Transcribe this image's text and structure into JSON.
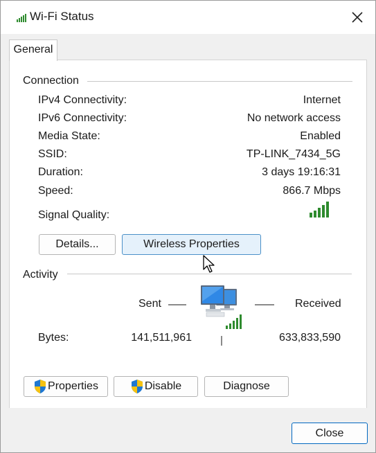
{
  "window": {
    "title": "Wi-Fi Status"
  },
  "tabs": [
    {
      "label": "General"
    }
  ],
  "connection": {
    "heading": "Connection",
    "rows": [
      {
        "label": "IPv4 Connectivity:",
        "value": "Internet"
      },
      {
        "label": "IPv6 Connectivity:",
        "value": "No network access"
      },
      {
        "label": "Media State:",
        "value": "Enabled"
      },
      {
        "label": "SSID:",
        "value": "TP-LINK_7434_5G"
      },
      {
        "label": "Duration:",
        "value": "3 days 19:16:31"
      },
      {
        "label": "Speed:",
        "value": "866.7 Mbps"
      }
    ],
    "signal_label": "Signal Quality:",
    "signal_bars": 5,
    "details_button": "Details...",
    "wireless_button": "Wireless Properties"
  },
  "activity": {
    "heading": "Activity",
    "sent_label": "Sent",
    "received_label": "Received",
    "bytes_label": "Bytes:",
    "bytes_sent": "141,511,961",
    "bytes_received": "633,833,590"
  },
  "actions": {
    "properties": "Properties",
    "disable": "Disable",
    "diagnose": "Diagnose"
  },
  "footer": {
    "close": "Close"
  },
  "colors": {
    "signal_green": "#2e8b2e",
    "accent_blue": "#0067c0",
    "shield_blue": "#1e78d2",
    "shield_yellow": "#f5c211"
  }
}
